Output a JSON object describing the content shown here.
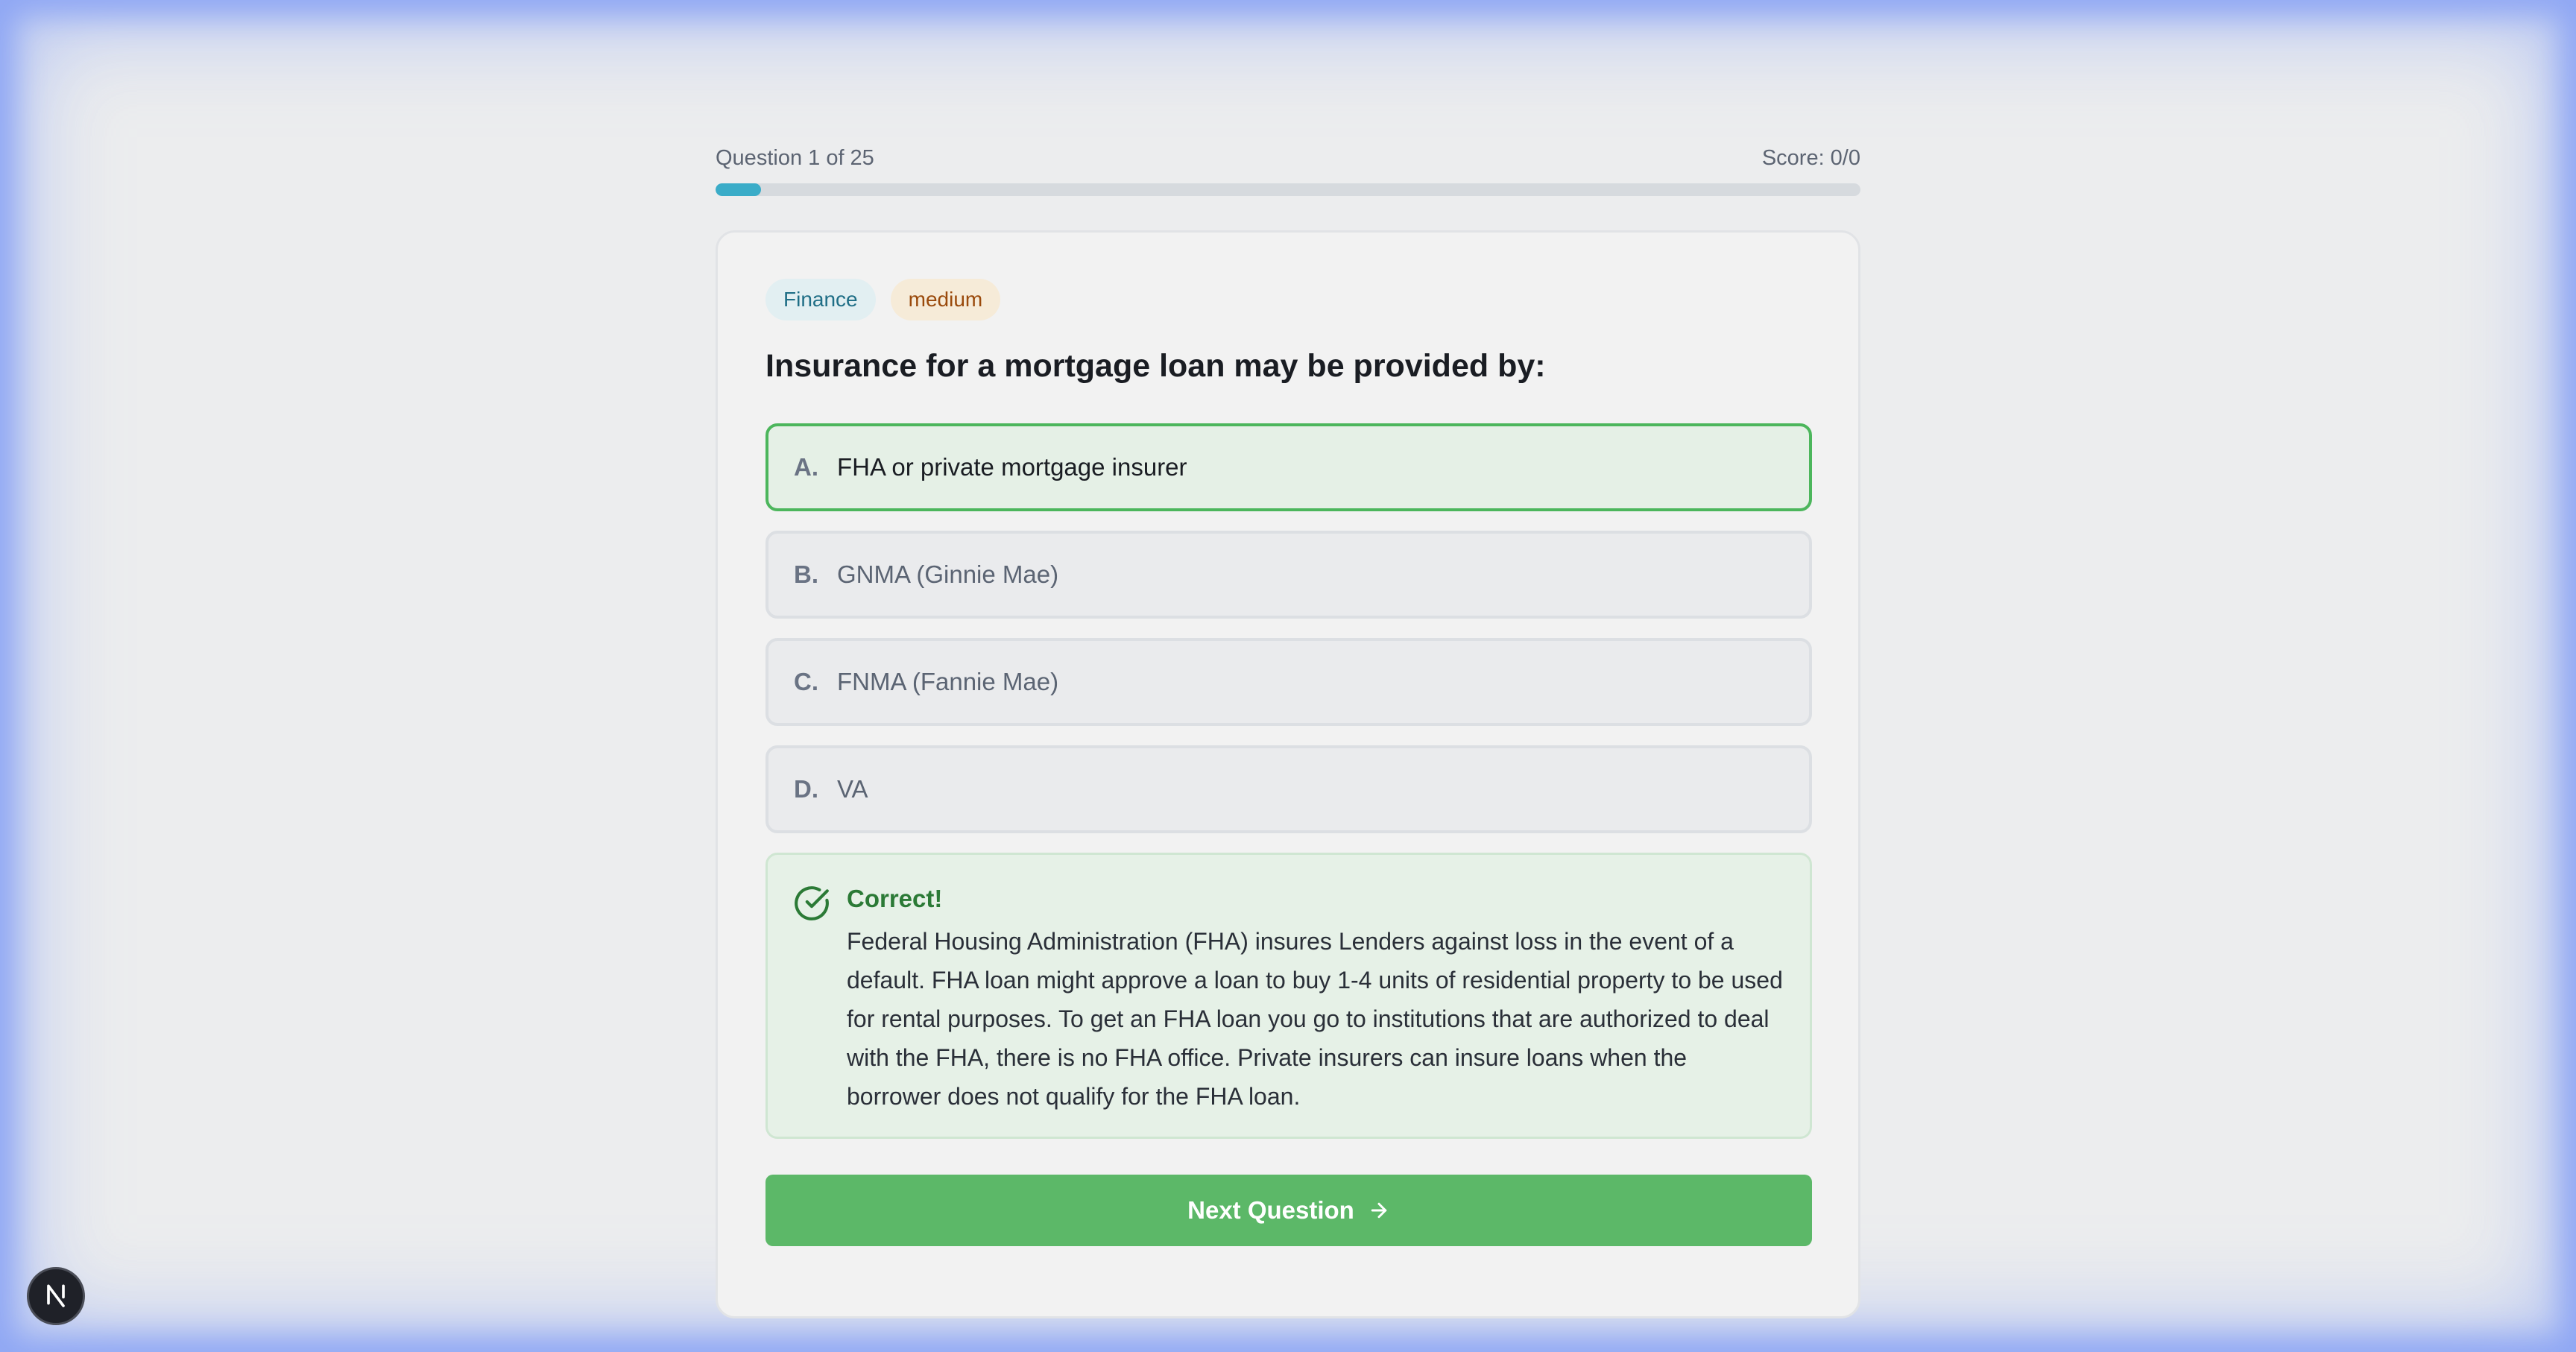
{
  "progress": {
    "label": "Question 1 of 25",
    "score": "Score: 0/0",
    "fraction": 0.04,
    "fill_color": "#3aacc8"
  },
  "question": {
    "category": "Finance",
    "difficulty": "medium",
    "text": "Insurance for a mortgage loan may be provided by:"
  },
  "options": [
    {
      "letter": "A.",
      "text": "FHA or private mortgage insurer",
      "state": "correct"
    },
    {
      "letter": "B.",
      "text": "GNMA (Ginnie Mae)",
      "state": "default"
    },
    {
      "letter": "C.",
      "text": "FNMA (Fannie Mae)",
      "state": "default"
    },
    {
      "letter": "D.",
      "text": "VA",
      "state": "default"
    }
  ],
  "feedback": {
    "icon": "check-circle-icon",
    "title": "Correct!",
    "text": "Federal Housing Administration (FHA) insures Lenders against loss in the event of a default. FHA loan might approve a loan to buy 1-4 units of residential property to be used for rental purposes. To get an FHA loan you go to institutions that are authorized to deal with the FHA, there is no FHA office. Private insurers can insure loans when the borrower does not qualify for the FHA loan."
  },
  "next_button": {
    "label": "Next Question",
    "icon": "arrow-right-icon",
    "color": "#5cb868"
  },
  "dev_badge": {
    "icon": "nextjs-logo-icon",
    "letter": "N"
  },
  "colors": {
    "correct_border": "#4cb65c",
    "correct_bg": "#e5f0e6",
    "success_text": "#2b7a36"
  }
}
